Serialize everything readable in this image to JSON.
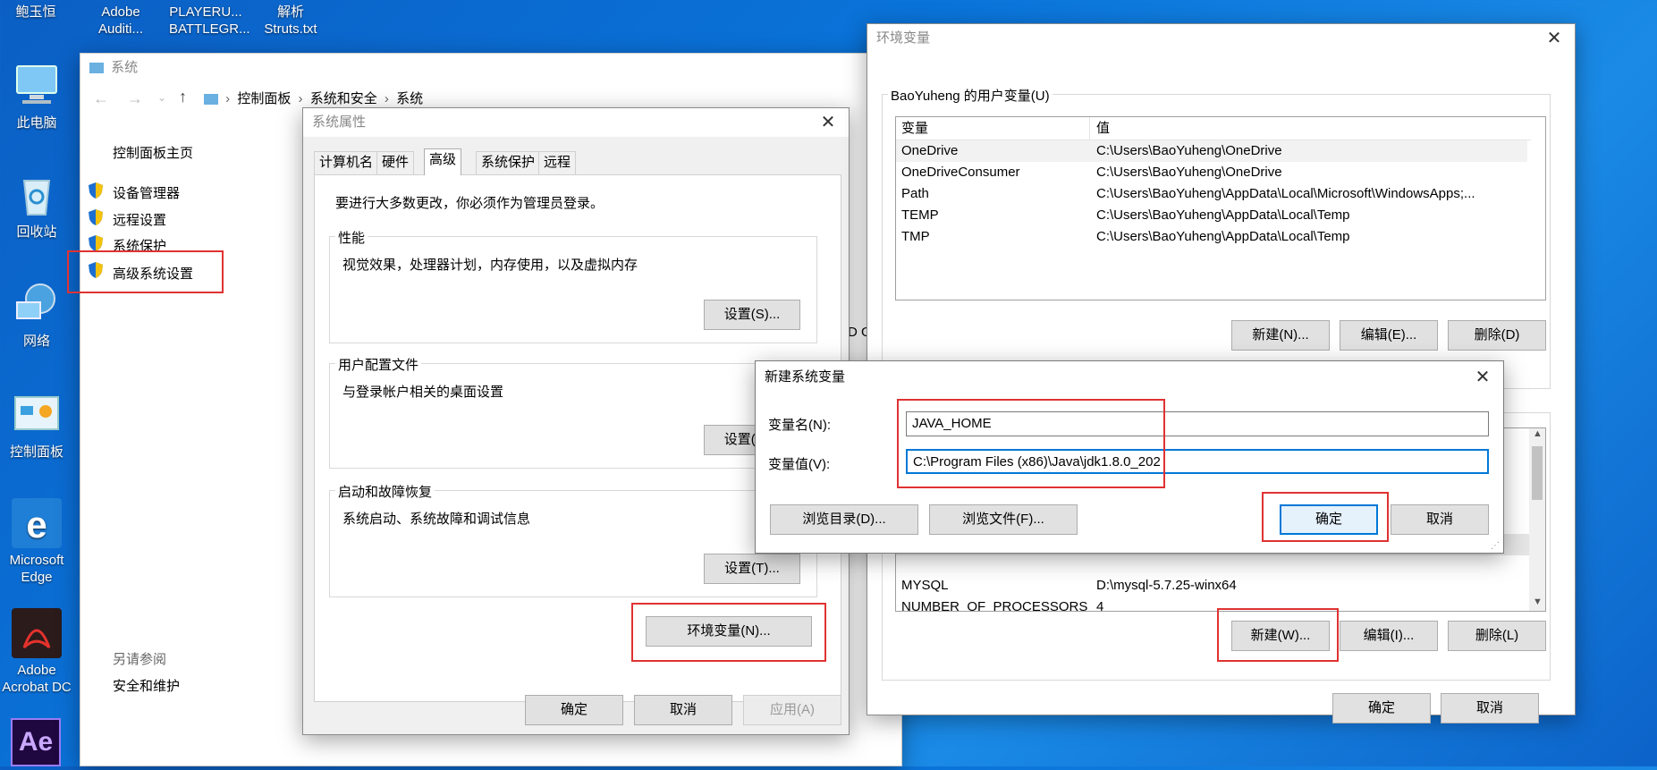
{
  "desktop": {
    "icons": [
      {
        "label": "鲍玉恒"
      },
      {
        "label": "Adobe Auditi..."
      },
      {
        "label": "PLAYERU... BATTLEGR..."
      },
      {
        "label": "解析 Struts.txt"
      },
      {
        "label": "此电脑"
      },
      {
        "label": "回收站"
      },
      {
        "label": "网络"
      },
      {
        "label": "控制面板"
      },
      {
        "label": "Microsoft Edge"
      },
      {
        "label": "Adobe Acrobat DC"
      },
      {
        "label": "Ae"
      }
    ]
  },
  "system_window": {
    "title": "系统",
    "breadcrumb": [
      "控制面板",
      "系统和安全",
      "系统"
    ],
    "nav_home": "控制面板主页",
    "nav_items": [
      "设备管理器",
      "远程设置",
      "系统保护",
      "高级系统设置"
    ],
    "see_also_heading": "另请参阅",
    "see_also_item": "安全和维护",
    "clipped_text": "D GI"
  },
  "sysprops": {
    "title": "系统属性",
    "tabs": [
      "计算机名",
      "硬件",
      "高级",
      "系统保护",
      "远程"
    ],
    "admin_note": "要进行大多数更改，你必须作为管理员登录。",
    "performance": {
      "label": "性能",
      "desc": "视觉效果，处理器计划，内存使用，以及虚拟内存",
      "button": "设置(S)..."
    },
    "profile": {
      "label": "用户配置文件",
      "desc": "与登录帐户相关的桌面设置",
      "button": "设置(E)..."
    },
    "startup": {
      "label": "启动和故障恢复",
      "desc": "系统启动、系统故障和调试信息",
      "button": "设置(T)..."
    },
    "env_button": "环境变量(N)...",
    "ok": "确定",
    "cancel": "取消",
    "apply": "应用(A)"
  },
  "envvars": {
    "title": "环境变量",
    "user_group_label": "BaoYuheng 的用户变量(U)",
    "col_var": "变量",
    "col_val": "值",
    "user_rows": [
      {
        "name": "OneDrive",
        "value": "C:\\Users\\BaoYuheng\\OneDrive"
      },
      {
        "name": "OneDriveConsumer",
        "value": "C:\\Users\\BaoYuheng\\OneDrive"
      },
      {
        "name": "Path",
        "value": "C:\\Users\\BaoYuheng\\AppData\\Local\\Microsoft\\WindowsApps;..."
      },
      {
        "name": "TEMP",
        "value": "C:\\Users\\BaoYuheng\\AppData\\Local\\Temp"
      },
      {
        "name": "TMP",
        "value": "C:\\Users\\BaoYuheng\\AppData\\Local\\Temp"
      }
    ],
    "user_new": "新建(N)...",
    "user_edit": "编辑(E)...",
    "user_delete": "删除(D)",
    "sys_rows": [
      {
        "name": "MYSQL",
        "value": "D:\\mysql-5.7.25-winx64"
      },
      {
        "name": "NUMBER_OF_PROCESSORS",
        "value": "4"
      }
    ],
    "sys_new": "新建(W)...",
    "sys_edit": "编辑(I)...",
    "sys_delete": "删除(L)",
    "ok": "确定",
    "cancel": "取消"
  },
  "newvar": {
    "title": "新建系统变量",
    "name_label": "变量名(N):",
    "name_value": "JAVA_HOME",
    "value_label": "变量值(V):",
    "value_value": "C:\\Program Files (x86)\\Java\\jdk1.8.0_202",
    "browse_dir": "浏览目录(D)...",
    "browse_file": "浏览文件(F)...",
    "ok": "确定",
    "cancel": "取消"
  },
  "colors": {
    "highlight": "#e03232",
    "accent": "#0078d7"
  }
}
